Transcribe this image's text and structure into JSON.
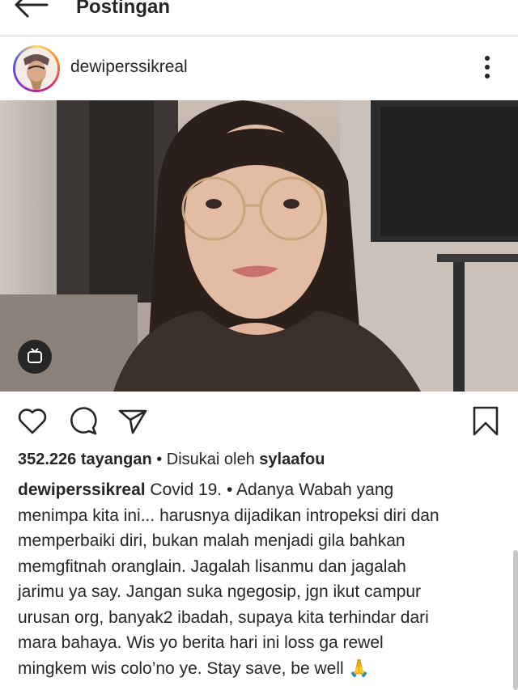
{
  "topbar": {
    "title": "Postingan"
  },
  "post": {
    "username": "dewiperssikreal",
    "views_count": "352.226 tayangan",
    "liked_by_prefix": "• Disukai oleh",
    "liked_by_user": "sylaafou",
    "caption_user": "dewiperssikreal",
    "caption_lines": [
      " Covid 19. • Adanya Wabah yang",
      "menimpa kita ini... harusnya dijadikan intropeksi diri dan",
      "memperbaiki diri, bukan malah menjadi gila bahkan",
      "memgfitnah oranglain. Jagalah lisanmu dan jagalah",
      "jarimu ya say. Jangan suka ngegosip, jgn ikut campur",
      "urusan org, banyak2 ibadah, supaya kita terhindar dari",
      "mara bahaya. Wis yo berita hari ini loss ga rewel",
      "mingkem wis colo’no ye.  Stay save, be well 🙏"
    ]
  },
  "icons": {
    "back": "arrow-left-icon",
    "more": "more-vertical-icon",
    "igtv": "igtv-icon",
    "like": "heart-icon",
    "comment": "comment-icon",
    "share": "send-icon",
    "save": "bookmark-icon"
  }
}
